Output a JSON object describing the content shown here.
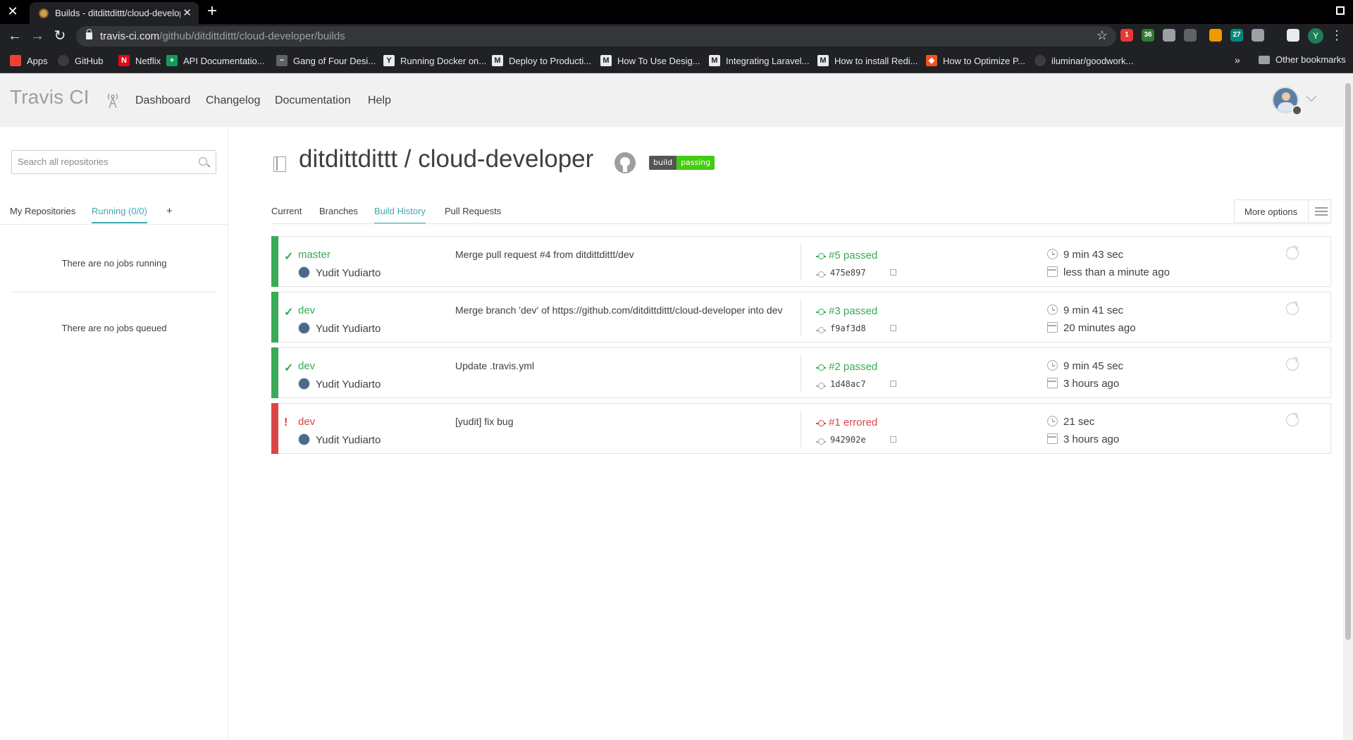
{
  "browser": {
    "tab_title": "Builds - ditdittdittt/cloud-developer",
    "url_host": "travis-ci.com",
    "url_path": "/github/ditdittdittt/cloud-developer/builds",
    "profile_initial": "Y",
    "extensions": [
      {
        "name": "ext-adblock-icon",
        "color": "#e53935",
        "badge": "1"
      },
      {
        "name": "ext-chat-icon",
        "color": "#2e7d32",
        "badge": "36"
      },
      {
        "name": "ext-globe-icon",
        "color": "#9aa0a6",
        "badge": ""
      },
      {
        "name": "ext-code-icon",
        "color": "#5f6368",
        "badge": ""
      },
      {
        "name": "ext-cookie-icon",
        "color": "#f29900",
        "badge": ""
      },
      {
        "name": "ext-calendar-icon",
        "color": "#00897b",
        "badge": "27"
      },
      {
        "name": "ext-shield-icon",
        "color": "#9aa0a6",
        "badge": ""
      },
      {
        "name": "ext-playlist-icon",
        "color": "#e8eaed",
        "badge": ""
      }
    ],
    "bookmarks": [
      {
        "label": "Apps",
        "icon": "apps-grid-icon",
        "color": "#ea4335",
        "glyph": ""
      },
      {
        "label": "GitHub",
        "icon": "github-icon",
        "color": "#3c3c3c",
        "glyph": ""
      },
      {
        "label": "Netflix",
        "icon": "netflix-icon",
        "color": "#e50914",
        "glyph": "N"
      },
      {
        "label": "API Documentatio...",
        "icon": "api-docs-icon",
        "color": "#0f9d58",
        "glyph": "+"
      },
      {
        "label": "Gang of Four Desi...",
        "icon": "gof-icon",
        "color": "#5f6368",
        "glyph": "~"
      },
      {
        "label": "Running Docker on...",
        "icon": "yb-icon",
        "color": "#e8eaed",
        "glyph": "Y"
      },
      {
        "label": "Deploy to Producti...",
        "icon": "medium-icon",
        "color": "#e8eaed",
        "glyph": "M"
      },
      {
        "label": "How To Use Desig...",
        "icon": "medium-icon",
        "color": "#e8eaed",
        "glyph": "M"
      },
      {
        "label": "Integrating Laravel...",
        "icon": "medium-icon",
        "color": "#e8eaed",
        "glyph": "M"
      },
      {
        "label": "How to install Redi...",
        "icon": "medium-icon",
        "color": "#e8eaed",
        "glyph": "M"
      },
      {
        "label": "How to Optimize P...",
        "icon": "laravel-icon",
        "color": "#f4511e",
        "glyph": "◆"
      },
      {
        "label": "iluminar/goodwork...",
        "icon": "github-icon",
        "color": "#3c3c3c",
        "glyph": ""
      }
    ],
    "bookmarks_more": "»",
    "other_bookmarks": "Other bookmarks"
  },
  "header": {
    "logo": "Travis CI",
    "nav": [
      "Dashboard",
      "Changelog",
      "Documentation",
      "Help"
    ]
  },
  "sidebar": {
    "search_placeholder": "Search all repositories",
    "tabs": [
      "My Repositories",
      "Running (0/0)"
    ],
    "add": "+",
    "no_running": "There are no jobs running",
    "no_queued": "There are no jobs queued"
  },
  "repo": {
    "title": "ditdittdittt / cloud-developer",
    "badge_left": "build",
    "badge_right": "passing"
  },
  "tabs": [
    "Current",
    "Branches",
    "Build History",
    "Pull Requests"
  ],
  "active_tab": "Build History",
  "more_options": "More options",
  "colors": {
    "passed": "#39aa56",
    "errored": "#db4545",
    "accent": "#3eaaaf"
  },
  "builds": [
    {
      "state": "passed",
      "status_icon": "✓",
      "branch": "master",
      "author": "Yudit Yudiarto",
      "message": "Merge pull request #4 from ditdittdittt/dev",
      "number": "#5 passed",
      "sha": "475e897",
      "duration": "9 min 43 sec",
      "finished": "less than a minute ago"
    },
    {
      "state": "passed",
      "status_icon": "✓",
      "branch": "dev",
      "author": "Yudit Yudiarto",
      "message": "Merge branch 'dev' of https://github.com/ditdittdittt/cloud-developer into dev",
      "number": "#3 passed",
      "sha": "f9af3d8",
      "duration": "9 min 41 sec",
      "finished": "20 minutes ago"
    },
    {
      "state": "passed",
      "status_icon": "✓",
      "branch": "dev",
      "author": "Yudit Yudiarto",
      "message": "Update .travis.yml",
      "number": "#2 passed",
      "sha": "1d48ac7",
      "duration": "9 min 45 sec",
      "finished": "3 hours ago"
    },
    {
      "state": "errored",
      "status_icon": "!",
      "branch": "dev",
      "author": "Yudit Yudiarto",
      "message": "[yudit] fix bug",
      "number": "#1 errored",
      "sha": "942902e",
      "duration": "21 sec",
      "finished": "3 hours ago"
    }
  ]
}
